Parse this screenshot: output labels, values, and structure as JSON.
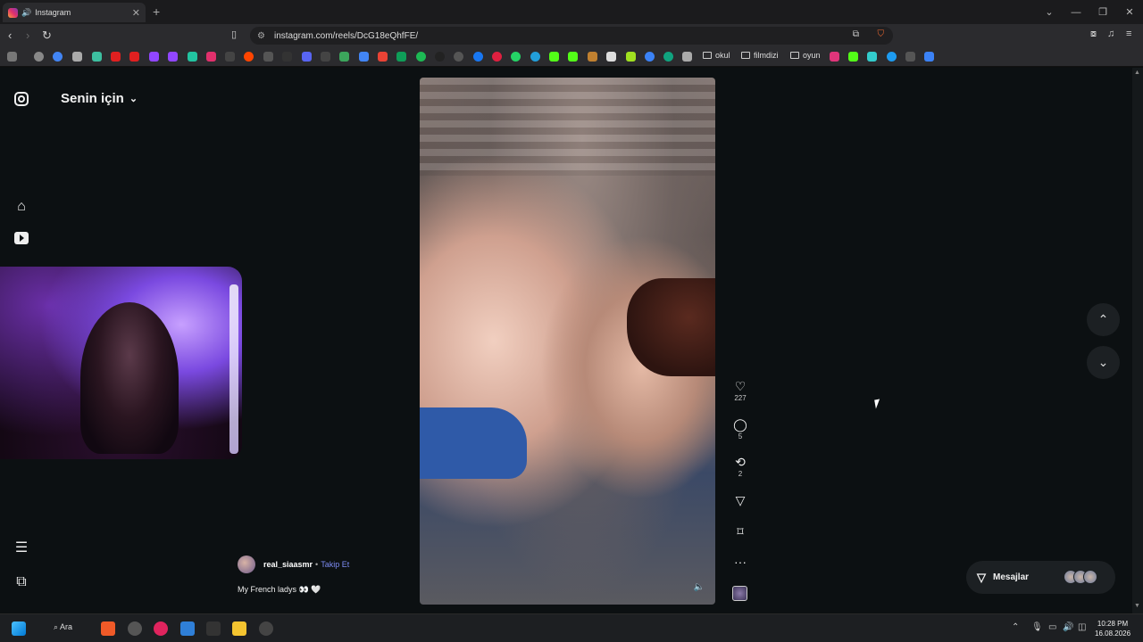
{
  "browser": {
    "tab_title": "Instagram",
    "url": "instagram.com/reels/DcG18eQhfFE/",
    "bookmark_folders": [
      "okul",
      "filmdizi",
      "oyun"
    ]
  },
  "sidebar": {
    "feed_label": "Senin için"
  },
  "reel": {
    "author": "real_siaasmr",
    "separator": "•",
    "follow_label": "Takip Et",
    "caption": "My French ladys 👀 🤍",
    "likes": "227",
    "comments": "5",
    "reposts": "2"
  },
  "messages": {
    "label": "Mesajlar"
  },
  "taskbar": {
    "search_label": "Ara",
    "time": "10:28 PM",
    "date": "16.08.2026"
  }
}
